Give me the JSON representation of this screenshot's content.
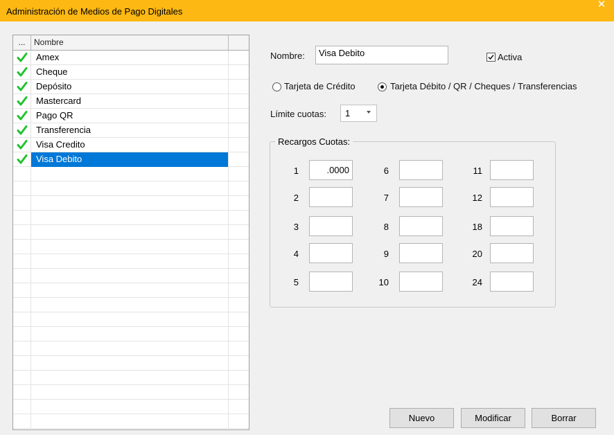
{
  "window": {
    "title": "Administración de Medios de Pago Digitales",
    "close_icon": "close-icon"
  },
  "grid": {
    "headers": {
      "dots": "...",
      "name": "Nombre"
    },
    "rows": [
      {
        "name": "Amex",
        "active": true,
        "selected": false
      },
      {
        "name": "Cheque",
        "active": true,
        "selected": false
      },
      {
        "name": "Depósito",
        "active": true,
        "selected": false
      },
      {
        "name": "Mastercard",
        "active": true,
        "selected": false
      },
      {
        "name": "Pago QR",
        "active": true,
        "selected": false
      },
      {
        "name": "Transferencia",
        "active": true,
        "selected": false
      },
      {
        "name": "Visa Credito",
        "active": true,
        "selected": false
      },
      {
        "name": "Visa Debito",
        "active": true,
        "selected": true
      }
    ],
    "check_color": "#22c22e",
    "selection_color": "#0078d7"
  },
  "form": {
    "nombre_label": "Nombre:",
    "nombre_value": "Visa Debito",
    "activa_label": "Activa",
    "activa_checked": true,
    "radio_credito_label": "Tarjeta de Crédito",
    "radio_debito_label": "Tarjeta Débito / QR / Cheques / Transferencias",
    "radio_selected": "debito",
    "limite_label": "Límite cuotas:",
    "limite_value": "1"
  },
  "recargos": {
    "label": "Recargos Cuotas:",
    "items": [
      {
        "n": "1",
        "value": ".0000"
      },
      {
        "n": "2",
        "value": ""
      },
      {
        "n": "3",
        "value": ""
      },
      {
        "n": "4",
        "value": ""
      },
      {
        "n": "5",
        "value": ""
      },
      {
        "n": "6",
        "value": ""
      },
      {
        "n": "7",
        "value": ""
      },
      {
        "n": "8",
        "value": ""
      },
      {
        "n": "9",
        "value": ""
      },
      {
        "n": "10",
        "value": ""
      },
      {
        "n": "11",
        "value": ""
      },
      {
        "n": "12",
        "value": ""
      },
      {
        "n": "18",
        "value": ""
      },
      {
        "n": "20",
        "value": ""
      },
      {
        "n": "24",
        "value": ""
      }
    ]
  },
  "buttons": {
    "nuevo": "Nuevo",
    "modificar": "Modificar",
    "borrar": "Borrar"
  },
  "colors": {
    "titlebar": "#fdb813"
  }
}
